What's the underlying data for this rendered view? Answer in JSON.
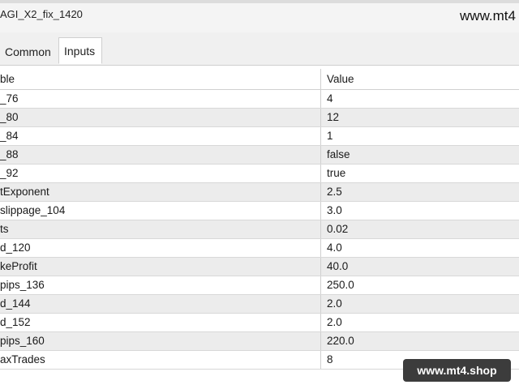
{
  "window": {
    "title": "AGI_X2_fix_1420",
    "watermark": "www.mt4"
  },
  "tabs": [
    {
      "label": "Common",
      "active": false
    },
    {
      "label": "Inputs",
      "active": true
    }
  ],
  "table": {
    "headers": {
      "variable": "ble",
      "value": "Value"
    },
    "rows": [
      {
        "variable": "_76",
        "value": "4"
      },
      {
        "variable": "_80",
        "value": "12"
      },
      {
        "variable": "_84",
        "value": "1"
      },
      {
        "variable": "_88",
        "value": "false"
      },
      {
        "variable": "_92",
        "value": "true"
      },
      {
        "variable": "tExponent",
        "value": "2.5"
      },
      {
        "variable": "slippage_104",
        "value": "3.0"
      },
      {
        "variable": "ts",
        "value": "0.02"
      },
      {
        "variable": "d_120",
        "value": "4.0"
      },
      {
        "variable": "keProfit",
        "value": "40.0"
      },
      {
        "variable": "pips_136",
        "value": "250.0"
      },
      {
        "variable": "d_144",
        "value": "2.0"
      },
      {
        "variable": "d_152",
        "value": "2.0"
      },
      {
        "variable": "pips_160",
        "value": "220.0"
      },
      {
        "variable": "axTrades",
        "value": "8"
      }
    ]
  },
  "badge": {
    "label": "www.mt4.shop"
  }
}
